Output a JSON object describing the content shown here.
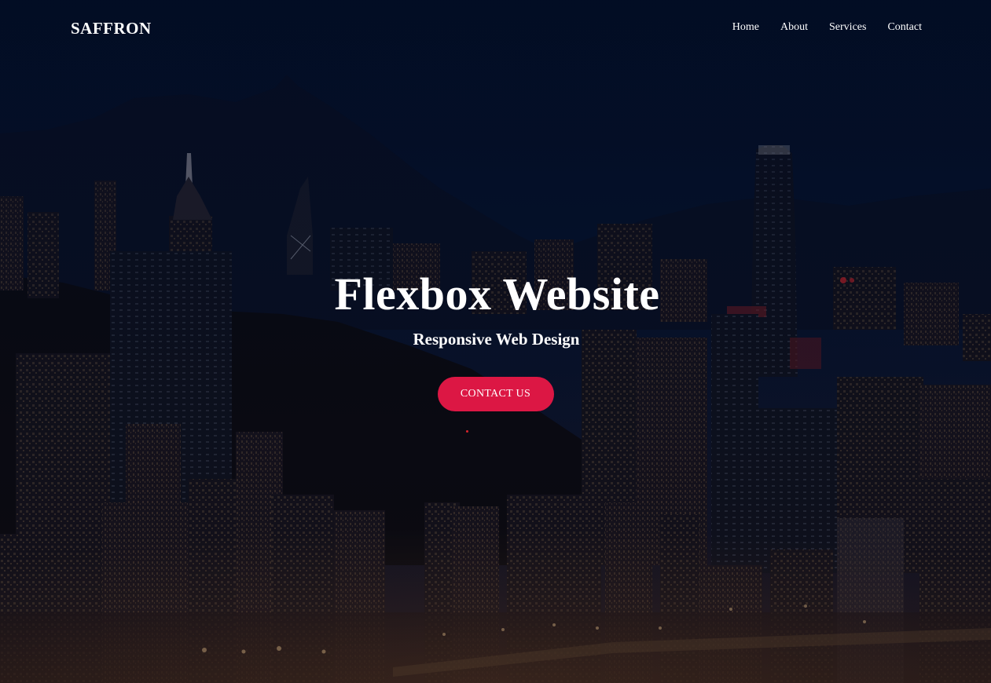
{
  "brand": {
    "logo_text": "SAFFRON"
  },
  "nav": {
    "items": [
      {
        "label": "Home"
      },
      {
        "label": "About"
      },
      {
        "label": "Services"
      },
      {
        "label": "Contact"
      }
    ]
  },
  "hero": {
    "title": "Flexbox Website",
    "subtitle": "Responsive Web Design",
    "cta_label": "CONTACT US"
  },
  "colors": {
    "accent": "#dc1744",
    "sky": "#041028",
    "text": "#ffffff"
  }
}
